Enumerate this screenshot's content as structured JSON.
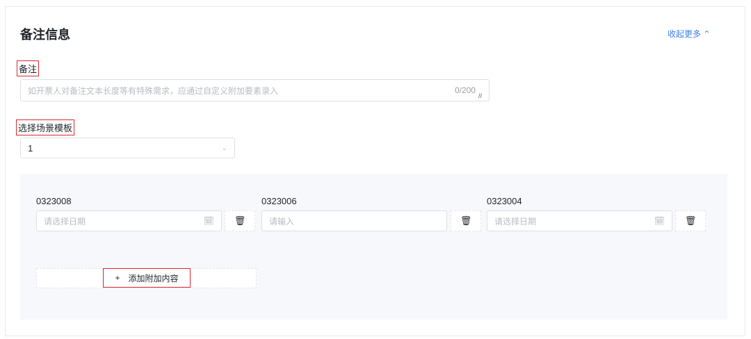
{
  "section": {
    "title": "备注信息",
    "collapse_label": "收起更多",
    "collapse_icon": "chevron-up-icon"
  },
  "remark": {
    "label": "备注",
    "placeholder": "如开票人对备注文本长度等有特殊需求，应通过自定义附加要素录入",
    "counter": "0/200"
  },
  "scene": {
    "label": "选择场景模板",
    "value": "1"
  },
  "fields": [
    {
      "label": "0323008",
      "placeholder": "请选择日期",
      "type": "date"
    },
    {
      "label": "0323006",
      "placeholder": "请输入",
      "type": "text"
    },
    {
      "label": "0323004",
      "placeholder": "请选择日期",
      "type": "date"
    }
  ],
  "add_button": {
    "icon": "+",
    "label": "添加附加内容"
  },
  "colors": {
    "accent": "#3a7ff0",
    "highlight": "#d9272e",
    "panel": "#f7f8fb"
  }
}
